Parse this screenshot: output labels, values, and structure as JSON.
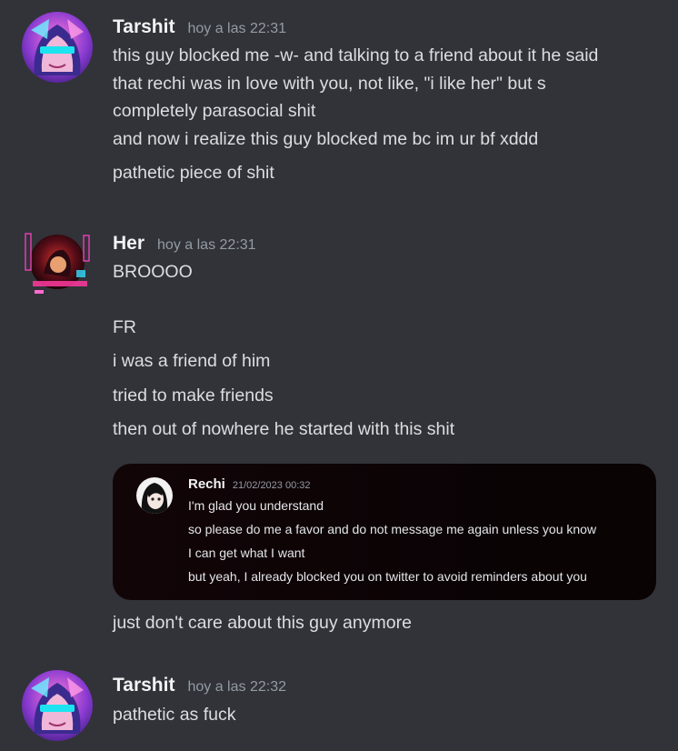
{
  "messages": [
    {
      "username": "Tarshit",
      "timestamp": "hoy a las 22:31",
      "lines": [
        "this guy blocked me -w- and talking to a friend about it he said",
        "that rechi was in love with you, not like, \"i like her\" but s",
        "completely parasocial shit",
        "and now i realize this guy blocked me bc im ur bf xddd",
        "pathetic piece of shit"
      ]
    },
    {
      "username": "Her",
      "timestamp": "hoy a las 22:31",
      "lines": [
        "BROOOO",
        "FR",
        "i was a friend of him",
        "tried to make friends",
        "then out of nowhere he started with this shit",
        "just don't care about this guy anymore"
      ],
      "embed": {
        "username": "Rechi",
        "timestamp": "21/02/2023 00:32",
        "lines": [
          "I'm glad you understand",
          "so please do me a favor and do not message me again unless you know",
          "I can get what I want",
          "but yeah, I already blocked you on twitter to avoid reminders about you"
        ]
      }
    },
    {
      "username": "Tarshit",
      "timestamp": "hoy a las 22:32",
      "lines": [
        "pathetic as fuck"
      ]
    }
  ]
}
